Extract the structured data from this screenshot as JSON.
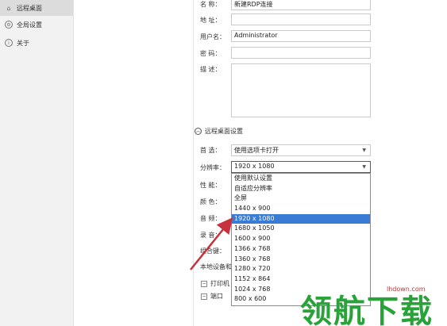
{
  "sidebar": {
    "items": [
      {
        "label": "远程桌面",
        "icon": "home-icon",
        "active": true
      },
      {
        "label": "全局设置",
        "icon": "gear-icon",
        "active": false
      },
      {
        "label": "关于",
        "icon": "info-icon",
        "active": false
      }
    ]
  },
  "form": {
    "name_label": "名 称：",
    "name_value": "新建RDP连接",
    "address_label": "地 址：",
    "address_value": "",
    "username_label": "用户名：",
    "username_value": "Administrator",
    "password_label": "密 码：",
    "password_value": "",
    "description_label": "描 述：",
    "description_value": ""
  },
  "section": {
    "title": "远程桌面设置",
    "chevron": "︿"
  },
  "settings": {
    "preference_label": "首 选：",
    "preference_value": "使用选项卡打开",
    "resolution_label": "分辨率：",
    "resolution_value": "1920 x 1080",
    "performance_label": "性 能：",
    "color_label": "颜 色：",
    "audio_label": "音 频：",
    "record_label": "录 音：",
    "hotkey_label": "组合键：",
    "local_devices_label": "本地设备和"
  },
  "dropdown": {
    "options": [
      "使用默认设置",
      "自适应分辨率",
      "全屏",
      "1440 x 900",
      "1920 x 1080",
      "1680 x 1050",
      "1600 x 900",
      "1366 x 768",
      "1360 x 768",
      "1280 x 720",
      "1152 x 864",
      "1024 x 768",
      "800 x 600"
    ],
    "selected_index": 4
  },
  "checkboxes": {
    "printer_label": "打印机",
    "port_label": "端口"
  },
  "watermark": {
    "text": "领航下载",
    "url": "lhdown.com"
  },
  "colors": {
    "accent": "#3a7bd5",
    "arrow": "#c8323c",
    "watermark": "#2aa23a"
  }
}
